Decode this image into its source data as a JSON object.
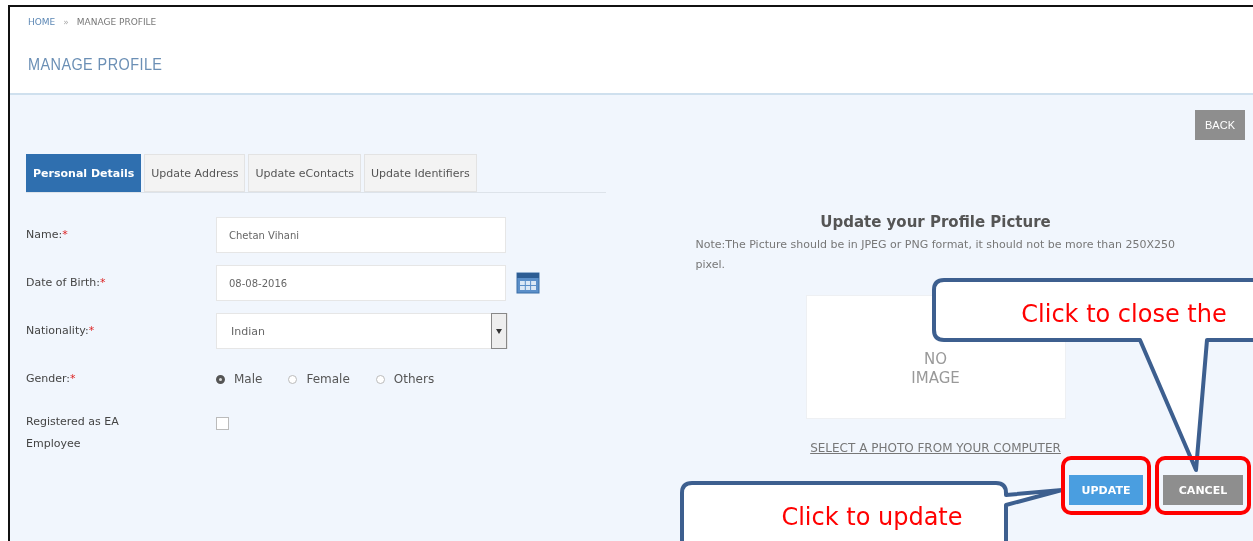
{
  "breadcrumb": [
    {
      "label": "HOME"
    },
    {
      "label": "MANAGE PROFILE"
    }
  ],
  "breadcrumb_separator": "»",
  "page_title": "MANAGE PROFILE",
  "back_button": "BACK",
  "tabs": [
    {
      "label": "Personal Details",
      "selected": true
    },
    {
      "label": "Update Address",
      "selected": false
    },
    {
      "label": "Update eContacts",
      "selected": false
    },
    {
      "label": "Update Identifiers",
      "selected": false
    }
  ],
  "form": [
    {
      "kind": "text",
      "label": "Name:",
      "required_mark": "*",
      "value": "Chetan Vihani"
    },
    {
      "kind": "date",
      "label": "Date of Birth:",
      "required_mark": "*",
      "value": "08-08-2016"
    },
    {
      "kind": "select",
      "label": "Nationality:",
      "required_mark": "*",
      "value": "Indian"
    },
    {
      "kind": "radio",
      "label": "Gender:",
      "required_mark": "*",
      "options": [
        {
          "label": "Male",
          "selected": true
        },
        {
          "label": "Female",
          "selected": false
        },
        {
          "label": "Others",
          "selected": false
        }
      ]
    },
    {
      "kind": "checkbox",
      "label": "Registered as EA Employee",
      "checked": false
    }
  ],
  "profile_picture": {
    "heading": "Update your Profile Picture",
    "note": "Note:The Picture should be in JPEG or PNG format, it should not be more than 250X250 pixel.",
    "placeholder_lines": [
      "NO",
      "IMAGE"
    ],
    "select_link": "SELECT A PHOTO FROM YOUR COMPUTER"
  },
  "buttons": [
    {
      "kind": "primary",
      "label": "UPDATE"
    },
    {
      "kind": "secondary",
      "label": "CANCEL"
    }
  ],
  "callouts": [
    {
      "text": "Click to close the"
    },
    {
      "text": "Click to update"
    }
  ]
}
